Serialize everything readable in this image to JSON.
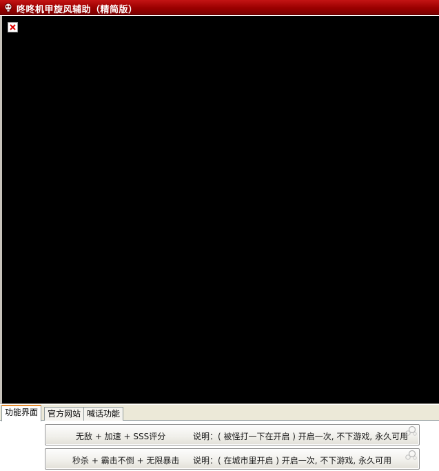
{
  "window": {
    "title": "咚咚机甲旋风辅助（精简版）",
    "icon": "skull-app-icon",
    "title_color": "#ffffff",
    "titlebar_color": "#9a0000"
  },
  "content_area": {
    "background": "#000000",
    "placeholder_icon": "broken-image-icon"
  },
  "tabs": [
    {
      "label": "功能界面",
      "active": true
    },
    {
      "label": "官方网站",
      "active": false
    },
    {
      "label": "喊话功能",
      "active": false
    }
  ],
  "actions": [
    {
      "name": "无敌 + 加速 + SSS评分",
      "description": "说明：( 被怪打一下在开启 ) 开启一次, 不下游戏, 永久可用"
    },
    {
      "name": "秒杀 + 霸击不倒 + 无限暴击",
      "description": "说明：( 在城市里开启 ) 开启一次, 不下游戏, 永久可用"
    }
  ]
}
